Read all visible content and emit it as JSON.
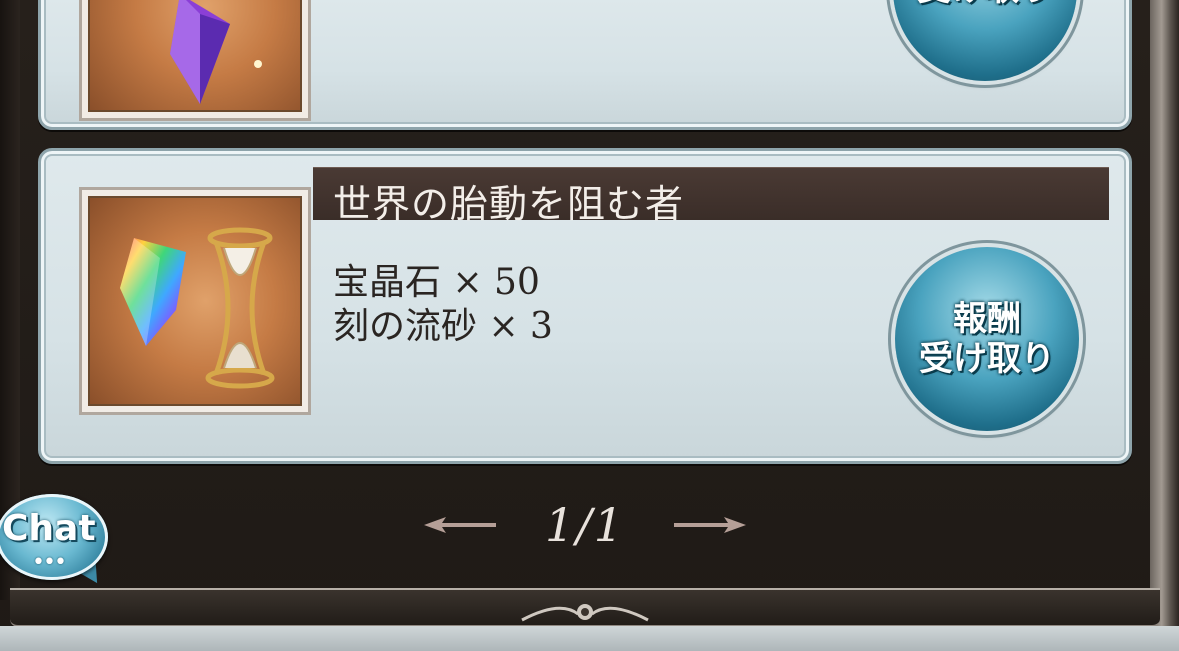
{
  "rewards": [
    {
      "title": "",
      "items": [],
      "button": {
        "line1": "",
        "line2": "受け取り"
      }
    },
    {
      "title": "世界の胎動を阻む者",
      "items": [
        "宝晶石 × 50",
        "刻の流砂 × 3"
      ],
      "button": {
        "line1": "報酬",
        "line2": "受け取り"
      }
    }
  ],
  "pagination": {
    "label": "1/1"
  },
  "chat": {
    "label": "Chat",
    "dots": "•••"
  },
  "colors": {
    "accent": "#4aa3bf",
    "title_band": "#3a2d28",
    "card_bg": "#d6e2e6"
  },
  "icons": [
    "crystal-icon",
    "hourglass-icon",
    "chevron-left-icon",
    "chevron-right-icon",
    "chat-bubble-icon"
  ]
}
